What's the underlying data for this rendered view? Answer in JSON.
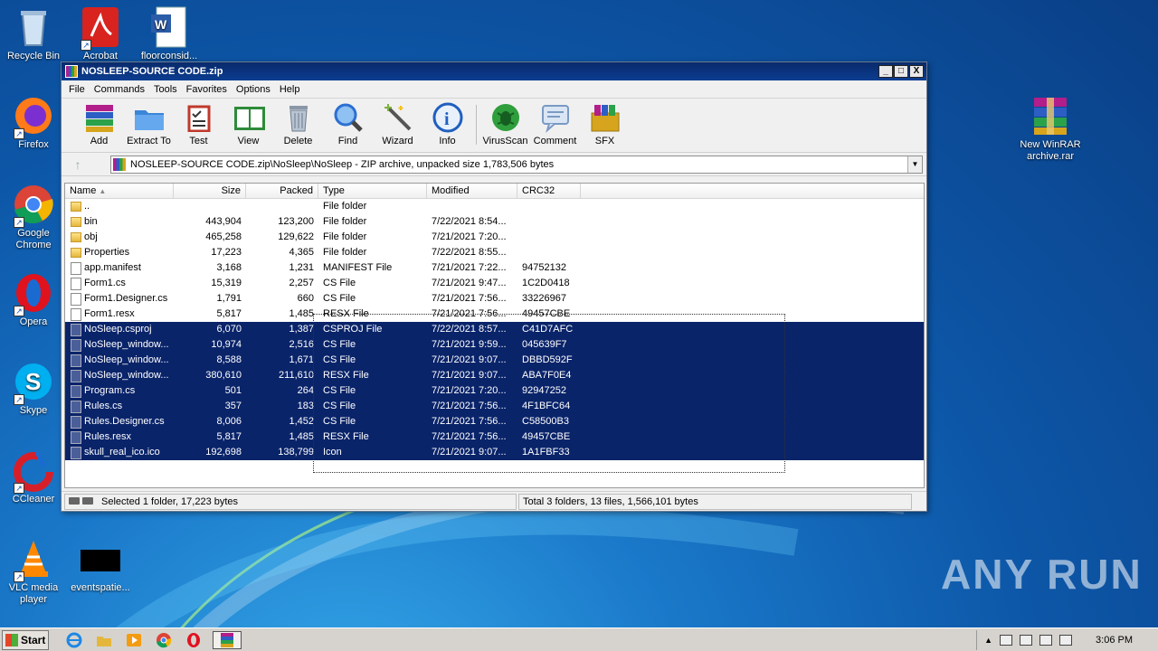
{
  "desktop": {
    "icons": [
      {
        "label": "Recycle Bin",
        "icon": "recycle-bin-icon"
      },
      {
        "label": "Acrobat",
        "icon": "acrobat-icon"
      },
      {
        "label": "floorconsid...",
        "icon": "word-doc-icon"
      },
      {
        "label": "Firefox",
        "icon": "firefox-icon"
      },
      {
        "label": "Google Chrome",
        "icon": "chrome-icon"
      },
      {
        "label": "Opera",
        "icon": "opera-icon"
      },
      {
        "label": "Skype",
        "icon": "skype-icon"
      },
      {
        "label": "CCleaner",
        "icon": "ccleaner-icon"
      },
      {
        "label": "VLC media player",
        "icon": "vlc-icon"
      },
      {
        "label": "eventspatie...",
        "icon": "blank-file-icon"
      },
      {
        "label": "New WinRAR archive.rar",
        "icon": "winrar-archive-icon"
      }
    ],
    "watermark": "ANY RUN"
  },
  "window": {
    "title": "NOSLEEP-SOURCE CODE.zip",
    "controls": [
      "_",
      "□",
      "X"
    ],
    "menu": [
      "File",
      "Commands",
      "Tools",
      "Favorites",
      "Options",
      "Help"
    ],
    "toolbar": [
      {
        "label": "Add",
        "icon": "add-icon",
        "color": "#b21e8a"
      },
      {
        "label": "Extract To",
        "icon": "extract-folder-icon",
        "color": "#3a86d8"
      },
      {
        "label": "Test",
        "icon": "test-clipboard-icon",
        "color": "#c0392b"
      },
      {
        "label": "View",
        "icon": "view-book-icon",
        "color": "#2e8b3a"
      },
      {
        "label": "Delete",
        "icon": "delete-trash-icon",
        "color": "#8a97a8"
      },
      {
        "label": "Find",
        "icon": "find-magnifier-icon",
        "color": "#2c6fd1"
      },
      {
        "label": "Wizard",
        "icon": "wizard-wand-icon",
        "color": "#7fb340"
      },
      {
        "label": "Info",
        "icon": "info-icon",
        "color": "#1f5fbf"
      },
      {
        "label": "VirusScan",
        "icon": "virusscan-bug-icon",
        "color": "#2f9e3c"
      },
      {
        "label": "Comment",
        "icon": "comment-icon",
        "color": "#7a9ac4"
      },
      {
        "label": "SFX",
        "icon": "sfx-box-icon",
        "color": "#d6a41d"
      }
    ],
    "address": "NOSLEEP-SOURCE CODE.zip\\NoSleep\\NoSleep - ZIP archive, unpacked size 1,783,506 bytes",
    "columns": [
      "Name",
      "Size",
      "Packed",
      "Type",
      "Modified",
      "CRC32"
    ],
    "files": [
      {
        "name": "..",
        "size": "",
        "packed": "",
        "type": "File folder",
        "modified": "",
        "crc": "",
        "kind": "folder",
        "selected": false
      },
      {
        "name": "bin",
        "size": "443,904",
        "packed": "123,200",
        "type": "File folder",
        "modified": "7/22/2021 8:54...",
        "crc": "",
        "kind": "folder",
        "selected": false
      },
      {
        "name": "obj",
        "size": "465,258",
        "packed": "129,622",
        "type": "File folder",
        "modified": "7/21/2021 7:20...",
        "crc": "",
        "kind": "folder",
        "selected": false
      },
      {
        "name": "Properties",
        "size": "17,223",
        "packed": "4,365",
        "type": "File folder",
        "modified": "7/22/2021 8:55...",
        "crc": "",
        "kind": "folder",
        "selected": false
      },
      {
        "name": "app.manifest",
        "size": "3,168",
        "packed": "1,231",
        "type": "MANIFEST File",
        "modified": "7/21/2021 7:22...",
        "crc": "94752132",
        "kind": "file",
        "selected": false
      },
      {
        "name": "Form1.cs",
        "size": "15,319",
        "packed": "2,257",
        "type": "CS File",
        "modified": "7/21/2021 9:47...",
        "crc": "1C2D0418",
        "kind": "file",
        "selected": false
      },
      {
        "name": "Form1.Designer.cs",
        "size": "1,791",
        "packed": "660",
        "type": "CS File",
        "modified": "7/21/2021 7:56...",
        "crc": "33226967",
        "kind": "file",
        "selected": false
      },
      {
        "name": "Form1.resx",
        "size": "5,817",
        "packed": "1,485",
        "type": "RESX File",
        "modified": "7/21/2021 7:56...",
        "crc": "49457CBE",
        "kind": "file",
        "selected": false
      },
      {
        "name": "NoSleep.csproj",
        "size": "6,070",
        "packed": "1,387",
        "type": "CSPROJ File",
        "modified": "7/22/2021 8:57...",
        "crc": "C41D7AFC",
        "kind": "file",
        "selected": true
      },
      {
        "name": "NoSleep_window...",
        "size": "10,974",
        "packed": "2,516",
        "type": "CS File",
        "modified": "7/21/2021 9:59...",
        "crc": "045639F7",
        "kind": "file",
        "selected": true
      },
      {
        "name": "NoSleep_window...",
        "size": "8,588",
        "packed": "1,671",
        "type": "CS File",
        "modified": "7/21/2021 9:07...",
        "crc": "DBBD592F",
        "kind": "file",
        "selected": true
      },
      {
        "name": "NoSleep_window...",
        "size": "380,610",
        "packed": "211,610",
        "type": "RESX File",
        "modified": "7/21/2021 9:07...",
        "crc": "ABA7F0E4",
        "kind": "file",
        "selected": true
      },
      {
        "name": "Program.cs",
        "size": "501",
        "packed": "264",
        "type": "CS File",
        "modified": "7/21/2021 7:20...",
        "crc": "92947252",
        "kind": "file",
        "selected": true
      },
      {
        "name": "Rules.cs",
        "size": "357",
        "packed": "183",
        "type": "CS File",
        "modified": "7/21/2021 7:56...",
        "crc": "4F1BFC64",
        "kind": "file",
        "selected": true
      },
      {
        "name": "Rules.Designer.cs",
        "size": "8,006",
        "packed": "1,452",
        "type": "CS File",
        "modified": "7/21/2021 7:56...",
        "crc": "C58500B3",
        "kind": "file",
        "selected": true
      },
      {
        "name": "Rules.resx",
        "size": "5,817",
        "packed": "1,485",
        "type": "RESX File",
        "modified": "7/21/2021 7:56...",
        "crc": "49457CBE",
        "kind": "file",
        "selected": true
      },
      {
        "name": "skull_real_ico.ico",
        "size": "192,698",
        "packed": "138,799",
        "type": "Icon",
        "modified": "7/21/2021 9:07...",
        "crc": "1A1FBF33",
        "kind": "file",
        "selected": true
      }
    ],
    "status_left": "Selected 1 folder, 17,223 bytes",
    "status_right": "Total 3 folders, 13 files, 1,566,101 bytes"
  },
  "taskbar": {
    "start_label": "Start",
    "apps": [
      "ie-icon",
      "explorer-icon",
      "media-player-icon",
      "chrome-icon",
      "opera-icon",
      "winrar-icon"
    ],
    "clock": "3:06 PM"
  }
}
